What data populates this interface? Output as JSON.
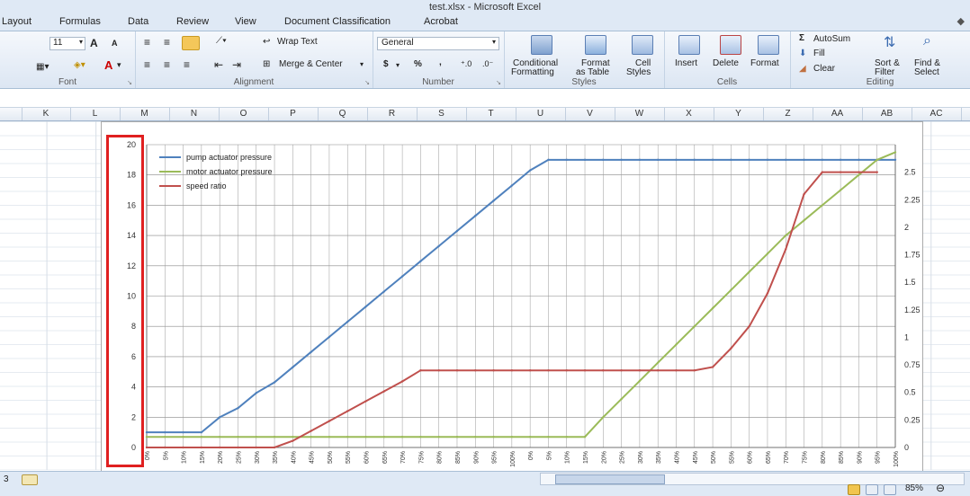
{
  "window": {
    "title": "test.xlsx - Microsoft Excel"
  },
  "tabs": [
    "Layout",
    "Formulas",
    "Data",
    "Review",
    "View",
    "Document Classification",
    "Acrobat"
  ],
  "ribbon": {
    "font": {
      "size": "11",
      "grow": "A",
      "shrink": "A",
      "label": "Font"
    },
    "alignment": {
      "wrap_text": "Wrap Text",
      "merge_center": "Merge & Center",
      "label": "Alignment"
    },
    "number": {
      "format": "General",
      "currency": "$",
      "percent": "%",
      "comma": ",",
      "label": "Number"
    },
    "styles": {
      "conditional_1": "Conditional",
      "conditional_2": "Formatting",
      "table_1": "Format",
      "table_2": "as Table",
      "cell_1": "Cell",
      "cell_2": "Styles",
      "label": "Styles"
    },
    "cells": {
      "insert": "Insert",
      "delete": "Delete",
      "format": "Format",
      "label": "Cells"
    },
    "editing": {
      "autosum": "AutoSum",
      "fill": "Fill",
      "clear": "Clear",
      "sort_1": "Sort &",
      "sort_2": "Filter",
      "find_1": "Find &",
      "find_2": "Select",
      "label": "Editing"
    }
  },
  "columns": [
    "K",
    "L",
    "M",
    "N",
    "O",
    "P",
    "Q",
    "R",
    "S",
    "T",
    "U",
    "V",
    "W",
    "X",
    "Y",
    "Z",
    "AA",
    "AB",
    "AC"
  ],
  "status": {
    "zoom": "85%",
    "sheet_tab": "3"
  },
  "chart_data": {
    "type": "line",
    "legend_position": "top-left",
    "grid": true,
    "primary_y": {
      "ylim": [
        0,
        20
      ],
      "ticks": [
        "0",
        "2",
        "4",
        "6",
        "8",
        "10",
        "12",
        "14",
        "16",
        "18",
        "20"
      ]
    },
    "secondary_y": {
      "ylim": [
        0,
        2.75
      ],
      "ticks": [
        "0",
        "0.25",
        "0.5",
        "0.75",
        "1",
        "1.25",
        "1.5",
        "1.75",
        "2",
        "2.25",
        "2.5"
      ]
    },
    "x_tick_labels": [
      "0%",
      "5%",
      "10%",
      "15%",
      "20%",
      "25%",
      "30%",
      "35%",
      "40%",
      "45%",
      "50%",
      "55%",
      "60%",
      "65%",
      "70%",
      "75%",
      "80%",
      "85%",
      "90%",
      "95%",
      "100%",
      "0%",
      "5%",
      "10%",
      "15%",
      "20%",
      "25%",
      "30%",
      "35%",
      "40%",
      "45%",
      "50%",
      "55%",
      "60%",
      "65%",
      "70%",
      "75%",
      "80%",
      "85%",
      "90%",
      "95%",
      "100%"
    ],
    "series": [
      {
        "name": "pump actuator pressure",
        "color": "#4f81bd",
        "axis": "primary",
        "values": [
          1,
          1,
          1,
          1,
          2,
          2.6,
          3.6,
          4.3,
          5.3,
          6.3,
          7.3,
          8.3,
          9.3,
          10.3,
          11.3,
          12.3,
          13.3,
          14.3,
          15.3,
          16.3,
          17.3,
          18.3,
          19,
          19,
          19,
          19,
          19,
          19,
          19,
          19,
          19,
          19,
          19,
          19,
          19,
          19,
          19,
          19,
          19,
          19,
          19,
          19
        ]
      },
      {
        "name": "motor actuator pressure",
        "color": "#9bbb59",
        "axis": "primary",
        "values": [
          0.7,
          0.7,
          0.7,
          0.7,
          0.7,
          0.7,
          0.7,
          0.7,
          0.7,
          0.7,
          0.7,
          0.7,
          0.7,
          0.7,
          0.7,
          0.7,
          0.7,
          0.7,
          0.7,
          0.7,
          0.7,
          0.7,
          0.7,
          0.7,
          0.7,
          2,
          3.2,
          4.4,
          5.6,
          6.8,
          8,
          9.2,
          10.4,
          11.6,
          12.8,
          14,
          15,
          16,
          17,
          18,
          19,
          19.5
        ]
      },
      {
        "name": "speed ratio",
        "color": "#c0504d",
        "axis": "secondary",
        "values": [
          0,
          0,
          0,
          0,
          0,
          0,
          0,
          0,
          0.06,
          0.15,
          0.24,
          0.33,
          0.42,
          0.51,
          0.6,
          0.7,
          0.7,
          0.7,
          0.7,
          0.7,
          0.7,
          0.7,
          0.7,
          0.7,
          0.7,
          0.7,
          0.7,
          0.7,
          0.7,
          0.7,
          0.7,
          0.73,
          0.9,
          1.1,
          1.4,
          1.8,
          2.3,
          2.5,
          2.5,
          2.5,
          2.5
        ]
      }
    ]
  }
}
